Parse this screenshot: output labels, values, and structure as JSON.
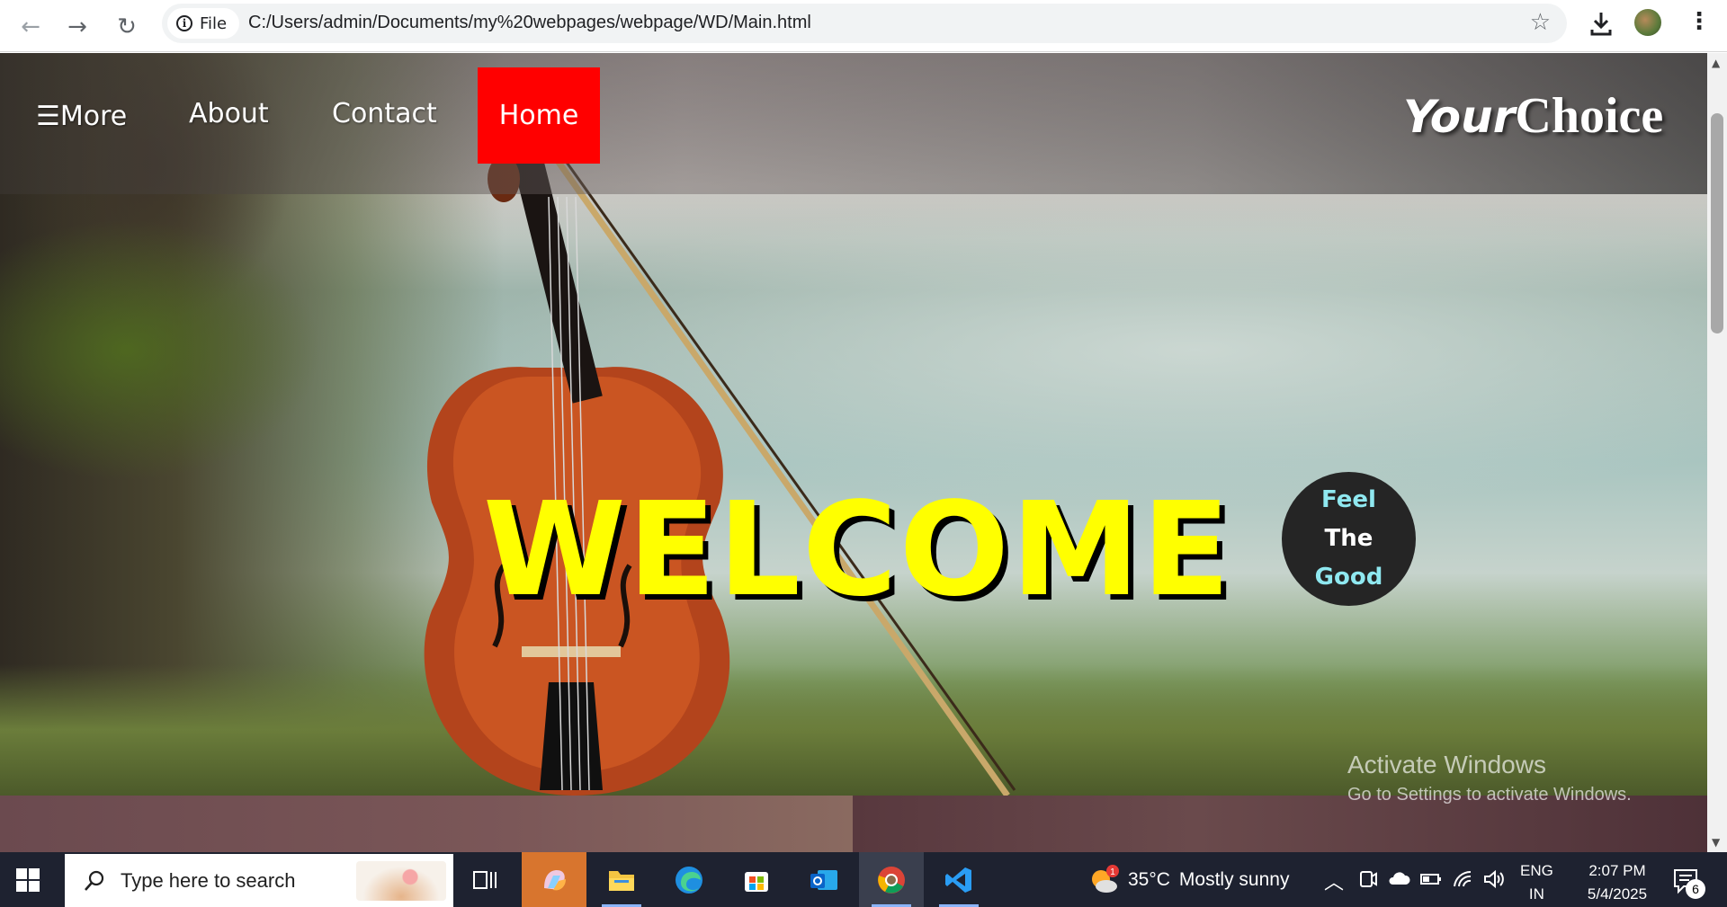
{
  "browser": {
    "back_icon": "←",
    "forward_icon": "→",
    "reload_icon": "↻",
    "site_chip_label": "File",
    "url": "C:/Users/admin/Documents/my%20webpages/webpage/WD/Main.html",
    "star_icon": "☆",
    "menu_icon": "⋮"
  },
  "page": {
    "nav": {
      "more_label": "☰More",
      "about_label": "About",
      "contact_label": "Contact",
      "home_label": "Home",
      "active_color": "#ff0000"
    },
    "logo": {
      "part1": "Your",
      "part2": "Choice"
    },
    "hero_title": "WELCOME",
    "hero_title_color": "#ffff00",
    "badge": {
      "line1": "Feel",
      "line2": "The",
      "line3": "Good"
    }
  },
  "watermark": {
    "title": "Activate Windows",
    "subtitle": "Go to Settings to activate Windows."
  },
  "taskbar": {
    "search_placeholder": "Type here to search",
    "weather": {
      "temp": "35°C",
      "condition": "Mostly sunny",
      "alert_count": "1"
    },
    "language": {
      "line1": "ENG",
      "line2": "IN"
    },
    "clock": {
      "time": "2:07 PM",
      "date": "5/4/2025"
    },
    "notification_count": "6"
  }
}
